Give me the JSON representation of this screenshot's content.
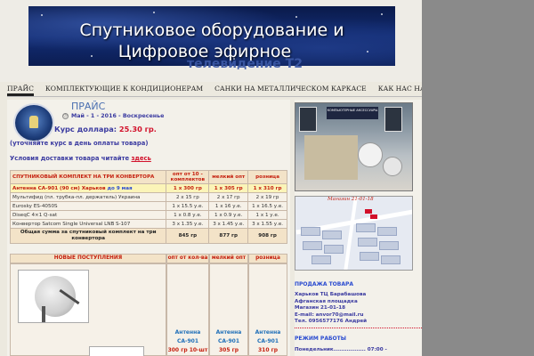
{
  "banner": {
    "line1": "Спутниковое оборудование и",
    "line2": "Цифровое эфирное",
    "line3": "телевидение Т2"
  },
  "nav": {
    "items": [
      {
        "label": "ПРАЙС",
        "active": true
      },
      {
        "label": "КОМПЛЕКТУЮЩИЕ К КОНДИЦИОНЕРАМ"
      },
      {
        "label": "САНКИ НА МЕТАЛЛИЧЕСКОМ КАРКАСЕ"
      },
      {
        "label": "КАК НАС НАЙТИ"
      }
    ]
  },
  "main": {
    "title": "ПРАЙС",
    "date": "Май - 1 - 2016 - Воскресенье",
    "usd_label": "Курс доллара:",
    "usd_rate": "25.30 гр.",
    "note": "(уточняйте курс в день оплаты товара)",
    "delivery_text": "Условия доставки товара читайте",
    "delivery_link": "здесь"
  },
  "price_table": {
    "headers": [
      "СПУТНИКОВЫЙ КОМПЛЕКТ НА ТРИ КОНВЕРТОРА",
      "опт от 10 - комплектов",
      "мелкий опт",
      "розница"
    ],
    "rows": [
      {
        "name": "Антенна CA-901 (90 см) Харьков",
        "extra": "до 9 мая",
        "opt": "1 х 300 гр",
        "small": "1 х 305 гр",
        "retail": "1 х 310 гр"
      },
      {
        "name": "Мультифид (пл. трубка-пл. держатель) Украина",
        "opt": "2 х 15 гр",
        "small": "2 х 17 гр",
        "retail": "2 х 19 гр"
      },
      {
        "name": "Eurosky ES-4050S",
        "opt": "1 х 15.5 у.е.",
        "small": "1 х 16 у.е.",
        "retail": "1 х 16.5 у.е."
      },
      {
        "name": "DiseqC 4×1 Q-sat",
        "opt": "1 х 0.8 у.е.",
        "small": "1 х 0.9 у.е.",
        "retail": "1 х 1 у.е."
      },
      {
        "name": "Конвертор Satcom Single Universal LNB S-107",
        "opt": "3 х 1.35 у.е.",
        "small": "3 х 1.45 у.е.",
        "retail": "3 х 1.55 у.е."
      }
    ],
    "total": {
      "label": "Общая сумма за спутниковый комплект на три конвертора",
      "opt": "845 гр",
      "small": "877 гр",
      "retail": "908 гр"
    }
  },
  "new_arrivals": {
    "headers": [
      "НОВЫЕ ПОСТУПЛЕНИЯ",
      "опт от кол-ва",
      "мелкий опт",
      "розница"
    ],
    "product_name": "Антенна",
    "product_model": "CA-901",
    "opt_price": "300 гр 10-шт",
    "small_price": "305 гр",
    "retail_price": "310 гр"
  },
  "sidebar": {
    "map_label": "Магазин 21-01-18",
    "photo_sign": "КОМПЬЮТЕРНЫЕ АКСЕССУАРЫ",
    "sale_title": "ПРОДАЖА ТОВАРА",
    "address": [
      "Харьков ТЦ Барабашова",
      "Афганская площадка",
      "Магазин 21-01-18",
      "E-mail: anvor70@mail.ru",
      "Тел. 0956577176 Андрей"
    ],
    "hours_title": "РЕЖИМ РАБОТЫ",
    "hours_line": "Понедельник................. 07:00 -"
  }
}
